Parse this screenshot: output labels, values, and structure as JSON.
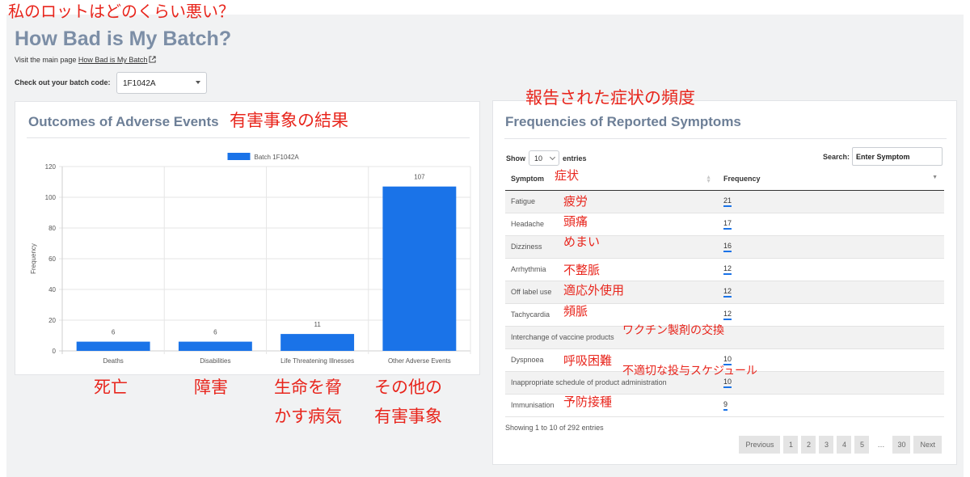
{
  "annotations": {
    "top_title": "私のロットはどのくらい悪い？",
    "outcomes": "有害事象の結果",
    "frequencies": "報告された症状の頻度",
    "symptom_col": "症状",
    "deaths": "死亡",
    "disabilities": "障害",
    "life_line1": "生命を脅",
    "life_line2": "かす病気",
    "other_line1": "その他の",
    "other_line2": "有害事象",
    "symptoms": [
      "疲労",
      "頭痛",
      "めまい",
      "不整脈",
      "適応外使用",
      "頻脈",
      "ワクチン製剤の交換",
      "呼吸困難",
      "不適切な投与スケジュール",
      "予防接種"
    ]
  },
  "header": {
    "title": "How Bad is My Batch?",
    "visit_prefix": "Visit the main page",
    "visit_link": "How Bad is My Batch",
    "batch_label": "Check out your batch code:",
    "batch_value": "1F1042A"
  },
  "left_panel": {
    "title": "Outcomes of Adverse Events"
  },
  "chart_data": {
    "type": "bar",
    "title": "",
    "categories": [
      "Deaths",
      "Disabilities",
      "Life Threatening Illnesses",
      "Other Adverse Events"
    ],
    "series": [
      {
        "name": "Batch 1F1042A",
        "values": [
          6,
          6,
          11,
          107
        ]
      }
    ],
    "data_labels": [
      "6",
      "6",
      "11",
      "107"
    ],
    "xlabel": "",
    "ylabel": "Frequency",
    "ylim": [
      0,
      120
    ],
    "yticks": [
      "0",
      "20",
      "40",
      "60",
      "80",
      "100",
      "120"
    ],
    "grid": true,
    "legend": "top",
    "bar_color": "#1a73e8"
  },
  "right_panel": {
    "title": "Frequencies of Reported Symptoms",
    "show_label": "Show",
    "show_value": "10",
    "entries_label": "entries",
    "search_label": "Search:",
    "search_placeholder": "Enter Symptom",
    "columns": [
      "Symptom",
      "Frequency"
    ],
    "rows": [
      {
        "symptom": "Fatigue",
        "frequency": "21"
      },
      {
        "symptom": "Headache",
        "frequency": "17"
      },
      {
        "symptom": "Dizziness",
        "frequency": "16"
      },
      {
        "symptom": "Arrhythmia",
        "frequency": "12"
      },
      {
        "symptom": "Off label use",
        "frequency": "12"
      },
      {
        "symptom": "Tachycardia",
        "frequency": "12"
      },
      {
        "symptom": "Interchange of vaccine products",
        "frequency": ""
      },
      {
        "symptom": "Dyspnoea",
        "frequency": "10"
      },
      {
        "symptom": "Inappropriate schedule of product administration",
        "frequency": "10"
      },
      {
        "symptom": "Immunisation",
        "frequency": "9"
      }
    ],
    "info": "Showing 1 to 10 of 292 entries",
    "pagination": {
      "previous": "Previous",
      "pages": [
        "1",
        "2",
        "3",
        "4",
        "5"
      ],
      "ellipsis": "…",
      "last": "30",
      "next": "Next"
    }
  }
}
